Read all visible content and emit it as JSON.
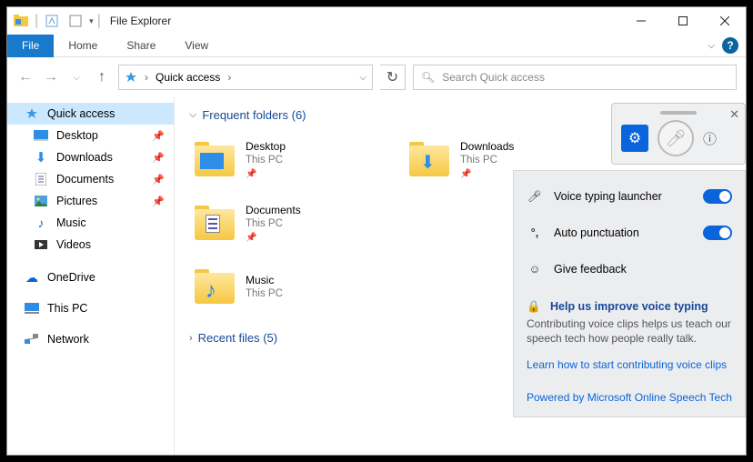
{
  "window": {
    "title": "File Explorer"
  },
  "ribbon": {
    "tabs": {
      "file": "File",
      "home": "Home",
      "share": "Share",
      "view": "View"
    }
  },
  "nav": {
    "breadcrumb": "Quick access",
    "search_placeholder": "Search Quick access"
  },
  "tree": {
    "quick_access": "Quick access",
    "desktop": "Desktop",
    "downloads": "Downloads",
    "documents": "Documents",
    "pictures": "Pictures",
    "music": "Music",
    "videos": "Videos",
    "onedrive": "OneDrive",
    "this_pc": "This PC",
    "network": "Network"
  },
  "sections": {
    "frequent": "Frequent folders (6)",
    "recent": "Recent files (5)"
  },
  "folders": [
    {
      "name": "Desktop",
      "sub": "This PC"
    },
    {
      "name": "Downloads",
      "sub": "This PC"
    },
    {
      "name": "Documents",
      "sub": "This PC"
    },
    {
      "name": "Music",
      "sub": "This PC"
    }
  ],
  "voice": {
    "launcher": "Voice typing launcher",
    "autopunc": "Auto punctuation",
    "feedback": "Give feedback",
    "improve_head": "Help us improve voice typing",
    "improve_body": "Contributing voice clips helps us teach our speech tech how people really talk.",
    "learn": "Learn how to start contributing voice clips",
    "powered": "Powered by Microsoft Online Speech Tech"
  },
  "icons": {
    "star": "star-icon",
    "folder": "folder-icon",
    "down": "download-icon",
    "doc": "document-icon",
    "pic": "pictures-icon",
    "music": "music-icon",
    "video": "videos-icon",
    "cloud": "onedrive-icon",
    "pc": "pc-icon",
    "net": "network-icon"
  },
  "colors": {
    "accent": "#1979ca",
    "link": "#0a64dc",
    "heading": "#16499a"
  }
}
